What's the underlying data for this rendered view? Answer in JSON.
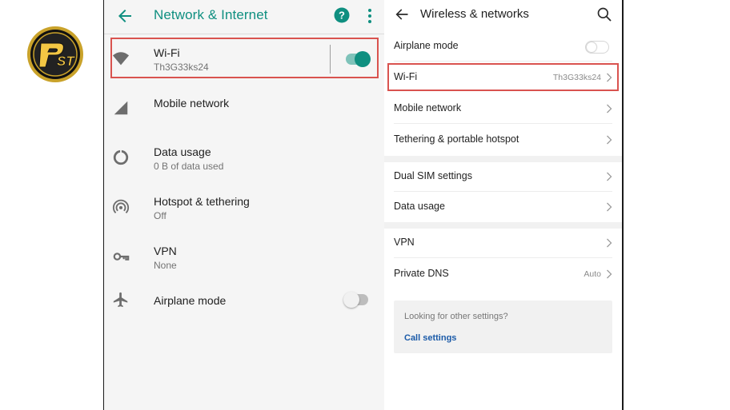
{
  "logo": {
    "text": "PST",
    "ring_color": "#c9a22a",
    "bg_color": "#1c1c1c"
  },
  "left_screen": {
    "header": {
      "title": "Network & Internet",
      "back_icon": "arrow-left-icon",
      "help_icon": "help-circle-icon",
      "more_icon": "more-vert-icon",
      "accent_color": "#0f8f80"
    },
    "items": [
      {
        "label": "Wi-Fi",
        "sub": "Th3G33ks24",
        "icon": "wifi-icon",
        "toggle": "on"
      },
      {
        "label": "Mobile network",
        "sub": "",
        "icon": "signal-icon"
      },
      {
        "label": "Data usage",
        "sub": "0 B of data used",
        "icon": "data-usage-icon"
      },
      {
        "label": "Hotspot & tethering",
        "sub": "Off",
        "icon": "hotspot-icon"
      },
      {
        "label": "VPN",
        "sub": "None",
        "icon": "key-icon"
      },
      {
        "label": "Airplane mode",
        "sub": "",
        "icon": "airplane-icon",
        "toggle": "off"
      }
    ],
    "highlight_color": "#d9534f"
  },
  "right_screen": {
    "header": {
      "title": "Wireless & networks",
      "back_icon": "arrow-left-icon",
      "search_icon": "search-icon"
    },
    "rows": [
      {
        "label": "Airplane mode",
        "value": "",
        "control": "toggle-off"
      },
      {
        "label": "Wi-Fi",
        "value": "Th3G33ks24",
        "control": "chevron"
      },
      {
        "label": "Mobile network",
        "value": "",
        "control": "chevron"
      },
      {
        "label": "Tethering & portable hotspot",
        "value": "",
        "control": "chevron"
      },
      {
        "label": "Dual SIM settings",
        "value": "",
        "control": "chevron"
      },
      {
        "label": "Data usage",
        "value": "",
        "control": "chevron"
      },
      {
        "label": "VPN",
        "value": "",
        "control": "chevron"
      },
      {
        "label": "Private DNS",
        "value": "Auto",
        "control": "chevron"
      }
    ],
    "card": {
      "text": "Looking for other settings?",
      "link": "Call settings",
      "link_color": "#1a5aa8"
    }
  }
}
